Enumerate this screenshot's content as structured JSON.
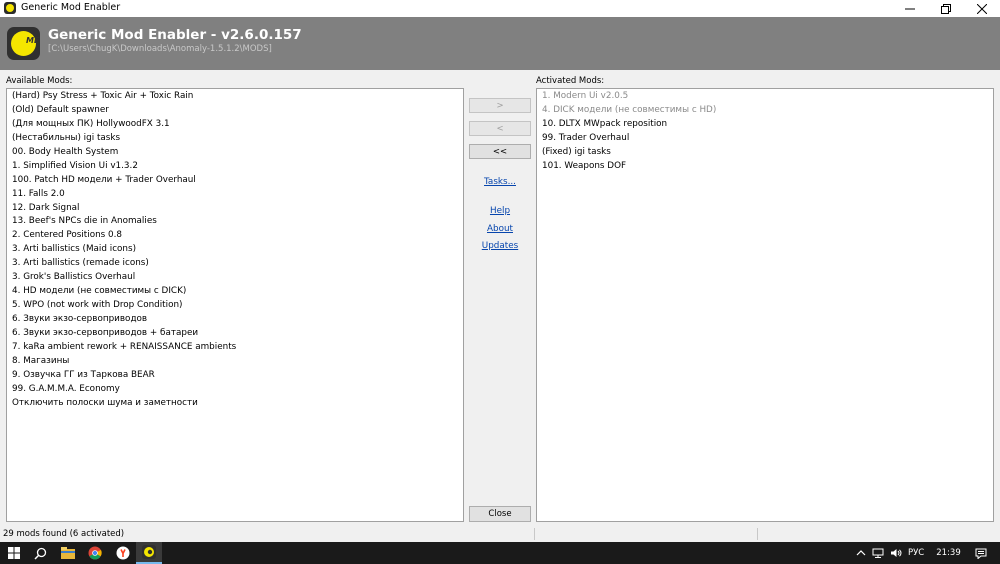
{
  "window": {
    "title": "Generic Mod Enabler",
    "icons": {
      "app": "gme-app-icon",
      "minimize": "minimize-icon",
      "maximize": "restore-icon",
      "close": "close-icon"
    }
  },
  "header": {
    "title": "Generic Mod Enabler - v2.6.0.157",
    "path": "[C:\\Users\\ChugK\\Downloads\\Anomaly-1.5.1.2\\MODS]",
    "logo_text": "ME"
  },
  "available": {
    "label": "Available Mods:",
    "items": [
      "(Hard) Psy Stress + Toxic Air + Toxic Rain",
      "(Old) Default spawner",
      "(Для мощных ПК) HollywoodFX 3.1",
      "(Нестабильны) igi tasks",
      "00. Body Health System",
      "1. Simplified Vision Ui v1.3.2",
      "100. Patch HD модели + Trader Overhaul",
      "11. Falls 2.0",
      "12. Dark Signal",
      "13. Beef's NPCs die in Anomalies",
      "2. Centered Positions 0.8",
      "3. Arti ballistics (Maid icons)",
      "3. Arti ballistics (remade icons)",
      "3. Grok's Ballistics Overhaul",
      "4. HD модели (не совместимы с DICK)",
      "5. WPO (not work with Drop Condition)",
      "6. Звуки экзо-сервоприводов",
      "6. Звуки экзо-сервоприводов + батареи",
      "7. kaRa ambient rework + RENAISSANCE ambients",
      "8. Магазины",
      "9. Озвучка ГГ из Таркова BEAR",
      "99. G.A.M.M.A. Economy",
      "Отключить полоски шума и заметности"
    ]
  },
  "activated": {
    "label": "Activated Mods:",
    "items": [
      {
        "text": "1. Modern Ui v2.0.5",
        "dim": true
      },
      {
        "text": "4. DICK модели (не совместимы с HD)",
        "dim": true
      },
      {
        "text": "10. DLTX MWpack reposition",
        "dim": false
      },
      {
        "text": "99. Trader Overhaul",
        "dim": false
      },
      {
        "text": "(Fixed) igi tasks",
        "dim": false
      },
      {
        "text": "101. Weapons DOF",
        "dim": false
      }
    ]
  },
  "buttons": {
    "activate": ">",
    "deactivate": "<",
    "deactivate_all": "<<",
    "close": "Close"
  },
  "links": {
    "tasks": "Tasks...",
    "help": "Help",
    "about": "About",
    "updates": "Updates"
  },
  "status": {
    "text": "29 mods found (6 activated)"
  },
  "taskbar": {
    "apps": [
      "start-icon",
      "search-icon",
      "file-explorer-icon",
      "chrome-icon",
      "yandex-browser-icon",
      "gme-taskbar-icon"
    ],
    "lang": "РУС",
    "time": "21:39",
    "tray_icons": [
      "chevron-up-icon",
      "network-icon",
      "volume-icon",
      "notifications-icon"
    ]
  }
}
